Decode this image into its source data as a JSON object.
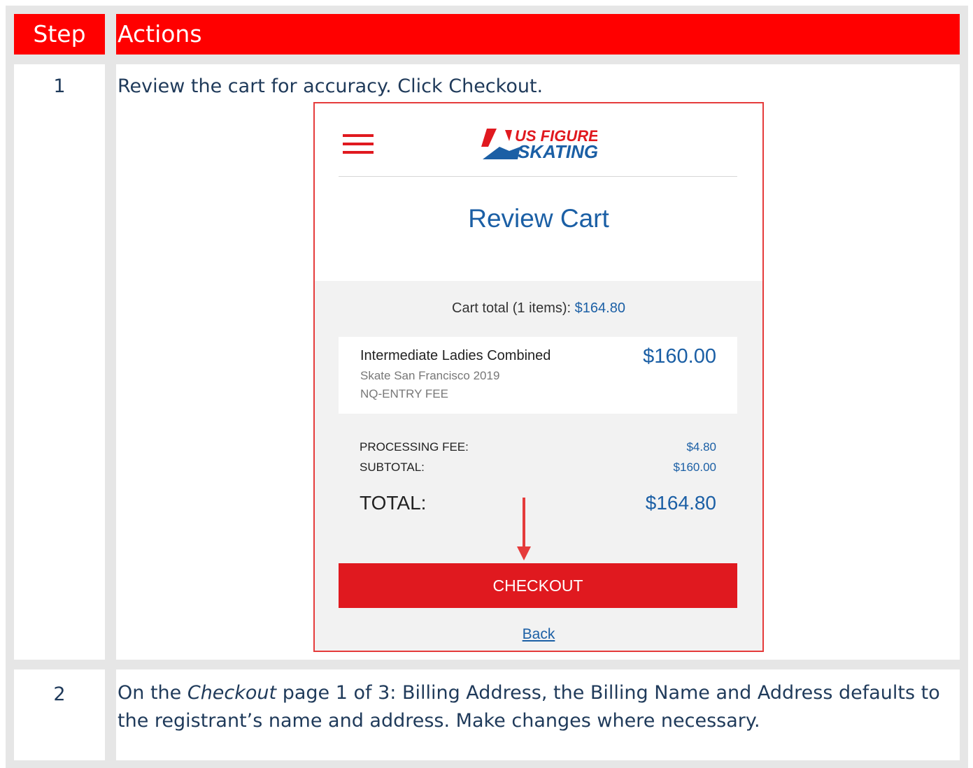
{
  "table": {
    "header": {
      "step": "Step",
      "actions": "Actions"
    },
    "rows": [
      {
        "step": "1",
        "text_before": "Review the cart for accuracy.  Click ",
        "text_bold": "Checkout",
        "text_after": "."
      },
      {
        "step": "2",
        "text_1": "On the ",
        "text_italic": "Checkout",
        "text_2": " page 1 of 3: Billing Address, the Billing Name and Address defaults to the registrant’s name and address.  Make changes where necessary."
      }
    ]
  },
  "screenshot": {
    "logo_text_1": "US FIGURE",
    "logo_text_2": "SKATING",
    "title": "Review Cart",
    "cart_total_label": "Cart total (1 items):",
    "cart_total_amount": "$164.80",
    "item": {
      "name": "Intermediate Ladies Combined",
      "event": "Skate San Francisco 2019",
      "fee_type": "NQ-ENTRY FEE",
      "price": "$160.00"
    },
    "processing_fee_label": "PROCESSING FEE:",
    "processing_fee_value": "$4.80",
    "subtotal_label": "SUBTOTAL:",
    "subtotal_value": "$160.00",
    "total_label": "TOTAL:",
    "total_value": "$164.80",
    "checkout_label": "CHECKOUT",
    "back_label": "Back"
  },
  "colors": {
    "header_red": "#ff0000",
    "brand_red": "#e0191f",
    "brand_blue": "#1b5fa5",
    "text_navy": "#1f3a5a"
  },
  "icons": [
    "hamburger-menu-icon",
    "us-figure-skating-logo",
    "red-down-arrow"
  ]
}
